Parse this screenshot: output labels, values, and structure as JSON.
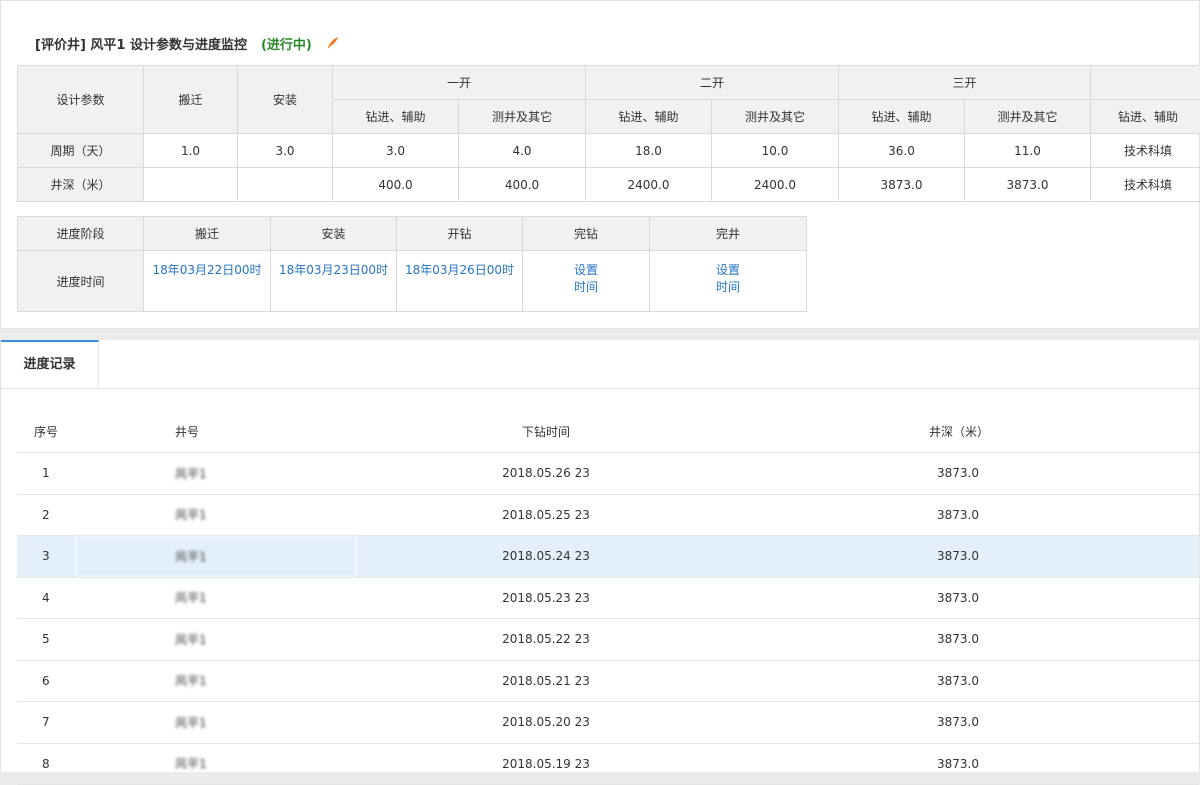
{
  "header": {
    "title": "[评价井] 风平1 设计参数与进度监控",
    "status": "(进行中)",
    "edit_icon": "pencil-icon",
    "status_color": "#2a8a2a"
  },
  "design_table": {
    "param_label": "设计参数",
    "move_label": "搬迁",
    "install_label": "安装",
    "stage1": "一开",
    "stage2": "二开",
    "stage3": "三开",
    "sub_drill": "钻进、辅助",
    "sub_logging": "测井及其它",
    "row_period_label": "周期（天）",
    "period": [
      "1.0",
      "3.0",
      "3.0",
      "4.0",
      "18.0",
      "10.0",
      "36.0",
      "11.0",
      "技术科填"
    ],
    "row_depth_label": "井深（米）",
    "depth": [
      "",
      "",
      "400.0",
      "400.0",
      "2400.0",
      "2400.0",
      "3873.0",
      "3873.0",
      "技术科填"
    ]
  },
  "progress_table": {
    "stage_label": "进度阶段",
    "time_label": "进度时间",
    "headers": [
      "搬迁",
      "安装",
      "开钻",
      "完钻",
      "完井"
    ],
    "times": [
      "18年03月22日00时",
      "18年03月23日00时",
      "18年03月26日00时"
    ],
    "set_time_line1": "设置",
    "set_time_line2": "时间",
    "link_color": "#2574c8"
  },
  "tabs": {
    "records": "进度记录",
    "active_color": "#3b8ee0"
  },
  "records_table": {
    "columns": [
      "序号",
      "井号",
      "下钻时间",
      "井深（米）"
    ],
    "rows": [
      {
        "no": "1",
        "well": "风平1",
        "time": "2018.05.26 23",
        "depth": "3873.0"
      },
      {
        "no": "2",
        "well": "风平1",
        "time": "2018.05.25 23",
        "depth": "3873.0"
      },
      {
        "no": "3",
        "well": "风平1",
        "time": "2018.05.24 23",
        "depth": "3873.0"
      },
      {
        "no": "4",
        "well": "风平1",
        "time": "2018.05.23 23",
        "depth": "3873.0"
      },
      {
        "no": "5",
        "well": "风平1",
        "time": "2018.05.22 23",
        "depth": "3873.0"
      },
      {
        "no": "6",
        "well": "风平1",
        "time": "2018.05.21 23",
        "depth": "3873.0"
      },
      {
        "no": "7",
        "well": "风平1",
        "time": "2018.05.20 23",
        "depth": "3873.0"
      },
      {
        "no": "8",
        "well": "风平1",
        "time": "2018.05.19 23",
        "depth": "3873.0"
      }
    ],
    "selected_row": 3,
    "selected_color": "#e3f0fc"
  }
}
